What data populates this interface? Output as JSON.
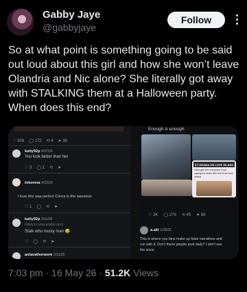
{
  "author": {
    "display_name": "Gabby Jaye",
    "handle": "@gabbyjaye",
    "follow_label": "Follow"
  },
  "tweet": {
    "text": "So at what point is something going to be said out loud about this girl and how she won’t leave Olandria and Nic alone? She literally got away with STALKING them at a Halloween party. When does this end?"
  },
  "media": {
    "left_screenshot": {
      "top_stats": [
        "306",
        "172",
        "4",
        "38"
      ],
      "replies": [
        {
          "user": "katty92p",
          "date": "4/27/26",
          "text": "You look better than her",
          "stats": [
            "3",
            "1"
          ]
        },
        {
          "user": "tokemoa",
          "date": "4/22/26",
          "text": "I love this was perfect Cierra is the sweetest",
          "stats": [
            "1"
          ]
        },
        {
          "user": "katty92p",
          "date": "3/11/26",
          "subtext": "Reply to unavailable post",
          "text": "Stalk who musty man 😂",
          "stats": []
        },
        {
          "user": "anlavatherwork",
          "date": "3/11/26",
          "text": "",
          "stats": []
        }
      ]
    },
    "right_screenshot": {
      "caption_top": "Enough is enough.",
      "overlay_title": "KY DRAMA ON LOVE ISLAND",
      "overlay_text": "Olan girl met everyone Kept saying he looks like him from love island",
      "stats": [
        "3K",
        "276",
        "45",
        "66"
      ],
      "reply_user": "a.alti",
      "reply_date": "12/8/25",
      "reply_text_1": "This is where you fans make up false narratives and",
      "reply_text_2": "run with it. Don't these people post daily? I don't see",
      "reply_text_3": "the issue."
    }
  },
  "footer": {
    "time": "7:03 pm",
    "date": "16 May 26",
    "views_count": "51.2K",
    "views_label": "Views",
    "separator": "·"
  },
  "colors": {
    "background": "#000000",
    "text_primary": "#e7e9ea",
    "text_secondary": "#71767b",
    "follow_bg": "#eff3f4"
  },
  "icons": [
    "more-vertical-icon",
    "reply-icon",
    "retweet-icon",
    "like-icon",
    "views-icon",
    "share-icon",
    "verified-icon"
  ]
}
